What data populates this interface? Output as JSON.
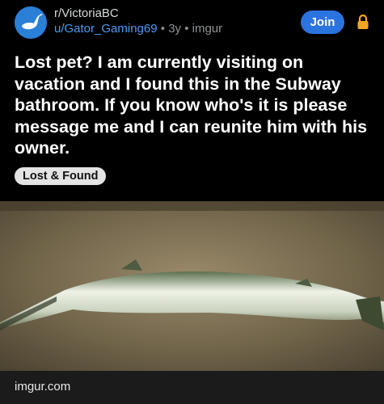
{
  "post": {
    "subreddit": "r/VictoriaBC",
    "author": "u/Gator_Gaming69",
    "separator": "•",
    "age": "3y",
    "domain": "imgur",
    "join_label": "Join",
    "title": "Lost pet? I am currently visiting on vacation and I found this in the Subway bathroom. If you know who's it is please message me and I can reunite him with his owner.",
    "flair": "Lost & Found",
    "link_domain": "imgur.com"
  },
  "icons": {
    "avatar": "goose-icon",
    "lock": "lock-icon"
  },
  "colors": {
    "background": "#000000",
    "join_button": "#2b74e0",
    "username": "#4a9bf0",
    "lock": "#f5a623",
    "flair_bg": "#e4e4e4"
  }
}
